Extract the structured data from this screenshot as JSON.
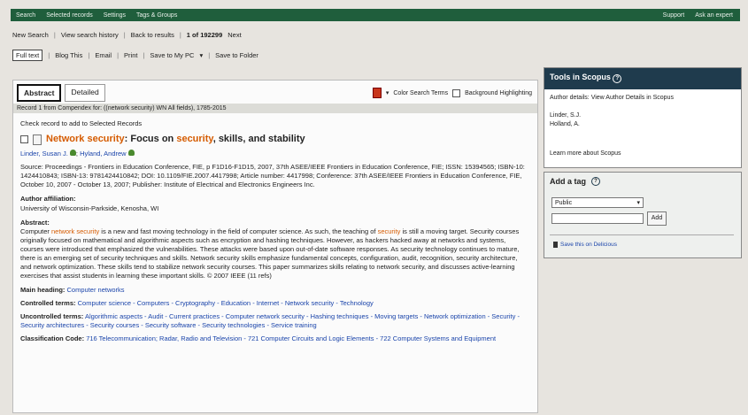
{
  "topbar": {
    "tabs": [
      "Search",
      "Selected records",
      "Settings",
      "Tags & Groups"
    ],
    "right": [
      "Support",
      "Ask an expert"
    ]
  },
  "navrow": {
    "new_search": "New Search",
    "view_history": "View search history",
    "back_to_results": "Back to results",
    "record_position": "1 of 192299",
    "next": "Next"
  },
  "toolrow": {
    "full_text": "Full text",
    "blog_this": "Blog This",
    "email": "Email",
    "print": "Print",
    "save_to_pc": "Save to My PC",
    "save_to_folder": "Save to Folder"
  },
  "main": {
    "tab_abstract": "Abstract",
    "tab_detailed": "Detailed",
    "color_search_terms": "Color Search Terms",
    "background_highlighting": "Background Highlighting",
    "record_strip": "Record 1 from Compendex for: ((network security) WN All fields), 1785-2015",
    "check_record": "Check record to add to Selected Records",
    "title_part1": "Network security",
    "title_part2": ": Focus on ",
    "title_part3": "security",
    "title_part4": ", skills, and stability",
    "authors": "Linder, Susan J.",
    "author2": "Hyland, Andrew",
    "source": "Source: Proceedings - Frontiers in Education Conference, FIE, p F1D16-F1D15, 2007, 37th ASEE/IEEE Frontiers in Education Conference, FIE; ISSN: 15394565; ISBN-10: 1424410843; ISBN-13: 9781424410842; DOI: 10.1109/FIE.2007.4417998; Article number: 4417998; Conference: 37th ASEE/IEEE Frontiers in Education Conference, FIE, October 10, 2007 - October 13, 2007; Publisher: Institute of Electrical and Electronics Engineers Inc.",
    "affiliation_head": "Author affiliation:",
    "affiliation": "University of Wisconsin-Parkside, Kenosha, WI",
    "abstract_head": "Abstract:",
    "abstract_a": "Computer ",
    "abstract_b": "network security",
    "abstract_c": " is a new and fast moving technology in the field of computer science. As such, the teaching of ",
    "abstract_d": "security",
    "abstract_e": " is still a moving target. Security courses originally focused on mathematical and algorithmic aspects such as encryption and hashing techniques. However, as hackers hacked away at networks and systems, courses were introduced that emphasized the vulnerabilities. These attacks were based upon out-of-date software responses. As security technology continues to mature, there is an emerging set of security techniques and skills. Network security skills emphasize fundamental concepts, configuration, audit, recognition, security architecture, and network optimization. These skills tend to stabilize network security courses. This paper summarizes skills relating to network security, and discusses active-learning exercises that assist students in learning these important skills. © 2007 IEEE (11 refs)",
    "main_heading_label": "Main heading:",
    "main_heading": "Computer networks",
    "controlled_label": "Controlled terms:",
    "controlled": "Computer science - Computers - Cryptography - Education - Internet - Network security - Technology",
    "uncontrolled_label": "Uncontrolled terms:",
    "uncontrolled": "Algorithmic aspects - Audit - Current practices - Computer network security - Hashing techniques - Moving targets - Network optimization - Security - Security architectures - Security courses - Security software - Security technologies - Service training",
    "classification_label": "Classification Code:",
    "classification": "716 Telecommunication; Radar, Radio and Television - 721 Computer Circuits and Logic Elements - 722 Computer Systems and Equipment"
  },
  "sidebar": {
    "title": "Tools in Scopus",
    "author_details": "Author details: View Author Details in Scopus",
    "author1": "Linder, S.J.",
    "author2": "Holland, A.",
    "learn_more": "Learn more about Scopus"
  },
  "tagbox": {
    "title": "Add a tag",
    "select_value": "Public",
    "add_label": "Add",
    "delicious": "Save this on Delicious"
  }
}
